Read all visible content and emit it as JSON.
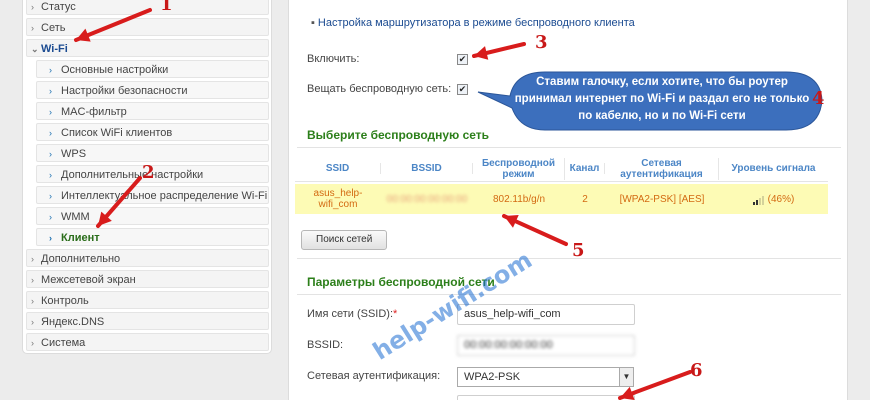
{
  "sidebar": {
    "items": [
      {
        "label": "Статус",
        "level": "top"
      },
      {
        "label": "Сеть",
        "level": "top"
      },
      {
        "label": "Wi-Fi",
        "level": "open"
      },
      {
        "label": "Основные настройки",
        "level": "sub"
      },
      {
        "label": "Настройки безопасности",
        "level": "sub"
      },
      {
        "label": "MAC-фильтр",
        "level": "sub"
      },
      {
        "label": "Список WiFi клиентов",
        "level": "sub"
      },
      {
        "label": "WPS",
        "level": "sub"
      },
      {
        "label": "Дополнительные настройки",
        "level": "sub"
      },
      {
        "label": "Интеллектуальное распределение Wi-Fi",
        "level": "sub"
      },
      {
        "label": "WMM",
        "level": "sub"
      },
      {
        "label": "Клиент",
        "level": "active"
      },
      {
        "label": "Дополнительно",
        "level": "top"
      },
      {
        "label": "Межсетевой экран",
        "level": "top"
      },
      {
        "label": "Контроль",
        "level": "top"
      },
      {
        "label": "Яндекс.DNS",
        "level": "top"
      },
      {
        "label": "Система",
        "level": "top"
      }
    ]
  },
  "main": {
    "breadcrumb": "Настройка маршрутизатора в режиме беспроводного клиента",
    "enable_label": "Включить:",
    "enable_checked": true,
    "broadcast_label": "Вещать беспроводную сеть:",
    "broadcast_checked": true,
    "select_network_title": "Выберите беспроводную сеть",
    "table": {
      "headers": [
        "SSID",
        "BSSID",
        "Беспроводной режим",
        "Канал",
        "Сетевая аутентификация",
        "Уровень сигнала"
      ],
      "rows": [
        {
          "ssid": "asus_help-wifi_com",
          "bssid": "00:00:00:00:00:00",
          "mode": "802.11b/g/n",
          "channel": "2",
          "auth": "[WPA2-PSK] [AES]",
          "signal": "(46%)",
          "signal_level": 0.46
        }
      ]
    },
    "search_button": "Поиск сетей",
    "params_title": "Параметры беспроводной сети",
    "ssid_label": "Имя сети (SSID):",
    "ssid_required_mark": "*",
    "ssid_value": "asus_help-wifi_com",
    "bssid_label": "BSSID:",
    "bssid_value": "00:00:00:00:00:00",
    "auth_label": "Сетевая аутентификация:",
    "auth_value": "WPA2-PSK"
  },
  "callout": {
    "text": "Ставим галочку, если хотите, что бы роутер принимал интернет по Wi-Fi и раздал его не только по кабелю, но и по Wi-Fi сети",
    "color": "#3c6fbd"
  },
  "annotations": {
    "numbers": [
      "1",
      "2",
      "3",
      "4",
      "5",
      "6"
    ],
    "arrow_color": "#d81c1c"
  },
  "watermark": "help-wifi.com"
}
